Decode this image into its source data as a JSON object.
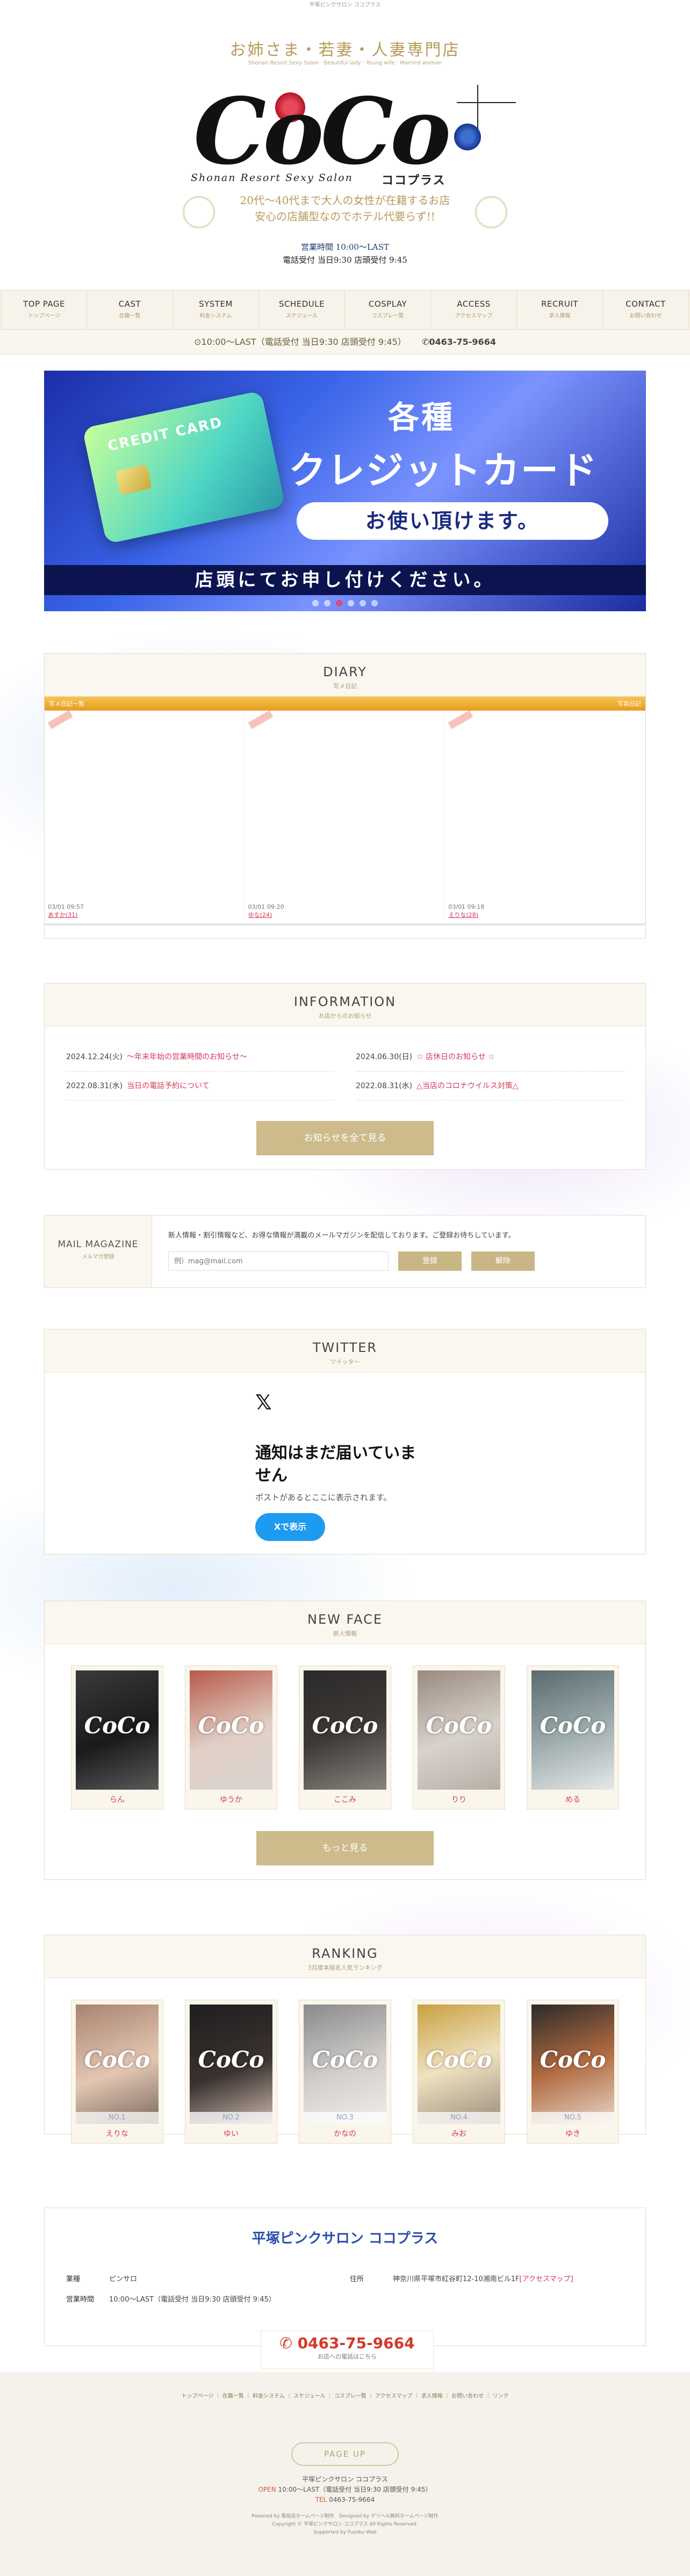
{
  "top_line": "平塚ピンクサロン ココプラス",
  "header": {
    "tagline": "お姉さま・若妻・人妻専門店",
    "tagline_sub": "Shonan Resort Sexy Salon · Beautiful lady · Young wife · Married woman",
    "logo_main": "CoCo",
    "logo_sub": "Shonan Resort Sexy Salon",
    "logo_kana": "ココプラス",
    "desc1": "20代～40代まで大人の女性が在籍するお店",
    "desc2": "安心の店舗型なのでホテル代要らず!!",
    "hours1": "営業時間 10:00～LAST",
    "hours2": "電話受付 当日9:30 店頭受付 9:45"
  },
  "nav": [
    {
      "en": "TOP PAGE",
      "jp": "トップページ"
    },
    {
      "en": "CAST",
      "jp": "在籍一覧"
    },
    {
      "en": "SYSTEM",
      "jp": "料金システム"
    },
    {
      "en": "SCHEDULE",
      "jp": "スケジュール"
    },
    {
      "en": "COSPLAY",
      "jp": "コスプレ一覧"
    },
    {
      "en": "ACCESS",
      "jp": "アクセスマップ"
    },
    {
      "en": "RECRUIT",
      "jp": "求人情報"
    },
    {
      "en": "CONTACT",
      "jp": "お問い合わせ"
    }
  ],
  "infobar": {
    "hours": "⊙10:00～LAST（電話受付 当日9:30 店頭受付 9:45）",
    "tel": "✆0463-75-9664"
  },
  "banner": {
    "card_label": "CREDIT CARD",
    "title1": "各種",
    "title2": "クレジットカード",
    "pill": "お使い頂けます。",
    "strip": "店頭にてお申し付けください。",
    "active_dot": 2,
    "dot_count": 6
  },
  "diary": {
    "title": "DIARY",
    "sub": "写メ日記",
    "bar_left": "写メ日記一覧",
    "bar_right": "写真日記",
    "entries": [
      {
        "date": "03/01 09:57",
        "name": "あすか(31)"
      },
      {
        "date": "03/01 09:20",
        "name": "ゆな(24)"
      },
      {
        "date": "03/01 09:18",
        "name": "えりな(28)"
      }
    ]
  },
  "information": {
    "title": "INFORMATION",
    "sub": "お店からのお知らせ",
    "items": [
      {
        "date": "2024.12.24(火)",
        "text": "〜年末年始の営業時間のお知らせ〜"
      },
      {
        "date": "2024.06.30(日)",
        "text": "☆ 店休日のお知らせ ☆"
      },
      {
        "date": "2022.08.31(水)",
        "text": "当日の電話予約について"
      },
      {
        "date": "2022.08.31(水)",
        "text": "△当店のコロナウイルス対策△"
      }
    ],
    "button": "お知らせを全て見る"
  },
  "mail": {
    "title": "MAIL MAGAZINE",
    "sub": "メルマガ登録",
    "desc": "新人情報・割引情報など、お得な情報が満載のメールマガジンを配信しております。ご登録お待ちしています。",
    "placeholder": "例）mag@mail.com",
    "register": "登録",
    "cancel": "解除"
  },
  "twitter": {
    "title": "TWITTER",
    "sub": "ツイッター",
    "x": "𝕏",
    "heading": "通知はまだ届いていません",
    "text": "ポストがあるとここに表示されます。",
    "button": "Xで表示"
  },
  "newface": {
    "title": "NEW FACE",
    "sub": "新人情報",
    "girls": [
      "らん",
      "ゆうか",
      "ここみ",
      "りり",
      "める"
    ],
    "button": "もっと見る"
  },
  "ranking": {
    "title": "RANKING",
    "sub": "3月度本指名人気ランキング",
    "girls": [
      {
        "rank": "NO.1",
        "name": "えりな"
      },
      {
        "rank": "NO.2",
        "name": "ゆい"
      },
      {
        "rank": "NO.3",
        "name": "かなの"
      },
      {
        "rank": "NO.4",
        "name": "みお"
      },
      {
        "rank": "NO.5",
        "name": "ゆき"
      }
    ]
  },
  "shop": {
    "title": "平塚ピンクサロン ココプラス",
    "type_label": "業種",
    "type": "ピンサロ",
    "addr_label": "住所",
    "addr": "神奈川県平塚市紅谷町12-10湘南ビル1F",
    "addr_link": "[アクセスマップ]",
    "hours_label": "営業時間",
    "hours": "10:00〜LAST（電話受付 当日9:30 店頭受付 9:45）",
    "tel": "0463-75-9664",
    "tel_sub": "お店への電話はこちら"
  },
  "footer": {
    "links": "トップページ ｜ 在籍一覧 ｜ 料金システム ｜ スケジュール ｜ コスプレ一覧 ｜ アクセスマップ ｜ 求人情報 ｜ お問い合わせ ｜ リンク",
    "pageup": "PAGE UP",
    "name": "平塚ピンクサロン ココプラス",
    "open_label": "OPEN",
    "open": "10:00〜LAST（電話受付 当日9:30 店頭受付 9:45）",
    "tel_label": "TEL",
    "tel": "0463-75-9664",
    "powered": "Powered by 風俗店ホームページ制作　Designed by デリヘル無料ホームページ制作",
    "copyright": "Copyright © 平塚ピンクサロン ココプラス All Rights Reserved.",
    "supported": "Supported by Fuzoku Web"
  }
}
